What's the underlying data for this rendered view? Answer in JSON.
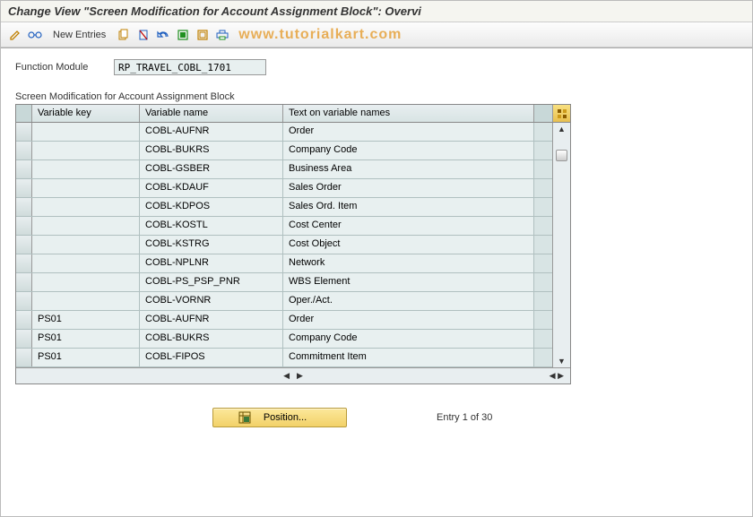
{
  "title": "Change View \"Screen Modification for Account Assignment Block\": Overvi",
  "watermark": "www.tutorialkart.com",
  "toolbar": {
    "new_entries": "New Entries"
  },
  "field": {
    "label": "Function Module",
    "value": "RP_TRAVEL_COBL_1701"
  },
  "section_label": "Screen Modification for Account Assignment Block",
  "columns": {
    "c1": "Variable key",
    "c2": "Variable name",
    "c3": "Text on variable names"
  },
  "rows": [
    {
      "k": "",
      "n": "COBL-AUFNR",
      "t": "Order"
    },
    {
      "k": "",
      "n": "COBL-BUKRS",
      "t": "Company Code"
    },
    {
      "k": "",
      "n": "COBL-GSBER",
      "t": "Business Area"
    },
    {
      "k": "",
      "n": "COBL-KDAUF",
      "t": "Sales Order"
    },
    {
      "k": "",
      "n": "COBL-KDPOS",
      "t": "Sales Ord. Item"
    },
    {
      "k": "",
      "n": "COBL-KOSTL",
      "t": "Cost Center"
    },
    {
      "k": "",
      "n": "COBL-KSTRG",
      "t": "Cost Object"
    },
    {
      "k": "",
      "n": "COBL-NPLNR",
      "t": "Network"
    },
    {
      "k": "",
      "n": "COBL-PS_PSP_PNR",
      "t": "WBS Element"
    },
    {
      "k": "",
      "n": "COBL-VORNR",
      "t": "Oper./Act."
    },
    {
      "k": "PS01",
      "n": "COBL-AUFNR",
      "t": "Order"
    },
    {
      "k": "PS01",
      "n": "COBL-BUKRS",
      "t": "Company Code"
    },
    {
      "k": "PS01",
      "n": "COBL-FIPOS",
      "t": "Commitment Item"
    }
  ],
  "position_btn": "Position...",
  "entry_text": "Entry 1 of 30"
}
